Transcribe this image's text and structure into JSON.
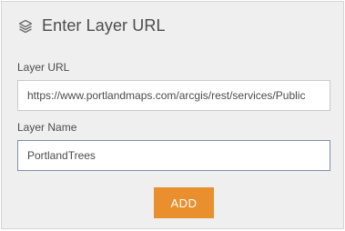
{
  "dialog": {
    "title": "Enter Layer URL",
    "icon": "layers-icon"
  },
  "layer_url": {
    "label": "Layer URL",
    "value": "https://www.portlandmaps.com/arcgis/rest/services/Public"
  },
  "layer_name": {
    "label": "Layer Name",
    "value": "PortlandTrees"
  },
  "add_button": {
    "label": "ADD",
    "color": "#e98f2e"
  },
  "colors": {
    "panel_bg": "#efefef",
    "text": "#4c4c4c",
    "accent": "#e98f2e"
  }
}
